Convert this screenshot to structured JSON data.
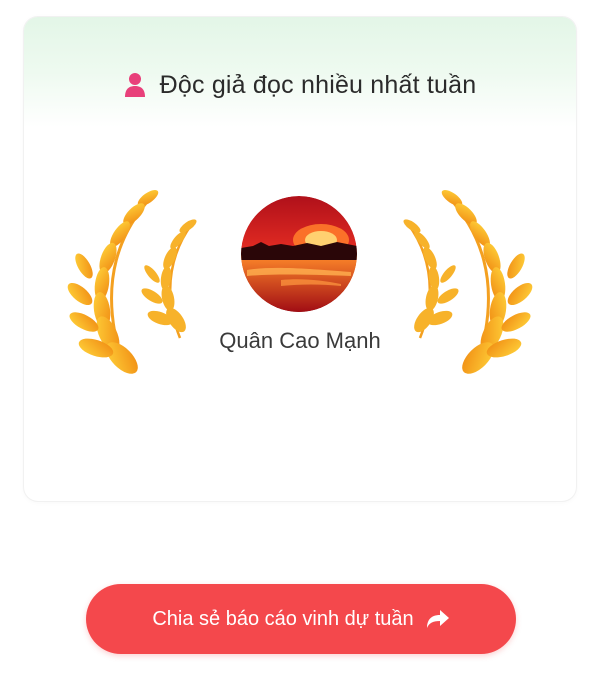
{
  "card": {
    "title": "Độc giả đọc nhiều nhất tuần",
    "title_icon": "user-icon",
    "reader": {
      "name": "Quân Cao Mạnh",
      "avatar": "avatar-sunset-image"
    },
    "decoration": "gold-laurel-icon"
  },
  "share_button": {
    "label": "Chia sẻ báo cáo vinh dự tuần",
    "icon": "share-arrow-icon",
    "color": "#f4484c"
  },
  "colors": {
    "header_tint": "#e3f6e7",
    "laurel_gold": "#f6a21a",
    "icon_pink": "#e8407a"
  }
}
